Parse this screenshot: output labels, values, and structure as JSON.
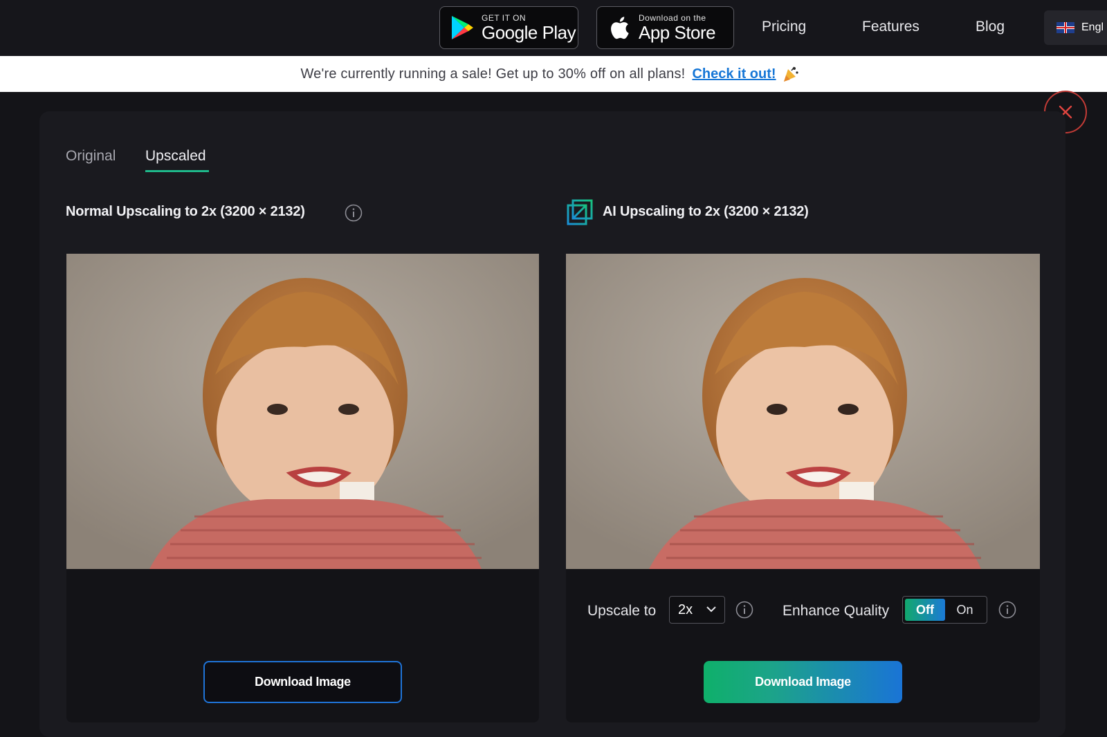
{
  "nav": {
    "google_play": {
      "small": "GET IT ON",
      "big": "Google Play",
      "icon": "google-play-icon"
    },
    "app_store": {
      "small": "Download on the",
      "big": "App Store",
      "icon": "apple-icon"
    },
    "links": [
      "Pricing",
      "Features",
      "Blog"
    ],
    "language": "Engl"
  },
  "banner": {
    "message": "We're currently running a sale! Get up to 30% off on all plans!",
    "cta": "Check it out!",
    "icon": "party-popper-icon"
  },
  "tabs": {
    "original": "Original",
    "upscaled": "Upscaled",
    "active": "Upscaled"
  },
  "left": {
    "title": "Normal Upscaling to 2x (3200 × 2132)",
    "download": "Download Image"
  },
  "right": {
    "title": "AI Upscaling to 2x (3200 × 2132)",
    "upscale_label": "Upscale to",
    "upscale_value": "2x",
    "enhance_label": "Enhance Quality",
    "toggle_off": "Off",
    "toggle_on": "On",
    "toggle_state": "Off",
    "download": "Download Image"
  },
  "colors": {
    "accent_green": "#1fb88a",
    "accent_blue": "#1f74d9",
    "close_red": "#c23b36"
  }
}
